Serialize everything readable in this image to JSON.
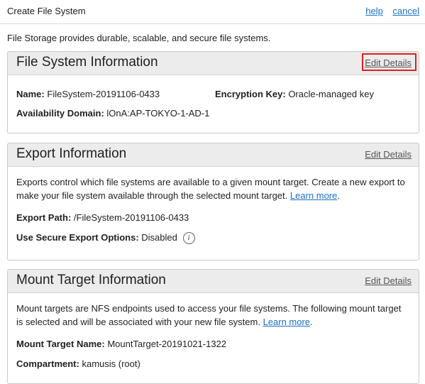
{
  "header": {
    "title": "Create File System",
    "help_label": "help",
    "cancel_label": "cancel"
  },
  "intro_text": "File Storage provides durable, scalable, and secure file systems.",
  "file_system_info": {
    "title": "File System Information",
    "edit_label": "Edit Details",
    "name_label": "Name:",
    "name_value": "FileSystem-20191106-0433",
    "encryption_label": "Encryption Key:",
    "encryption_value": "Oracle-managed key",
    "ad_label": "Availability Domain:",
    "ad_value": "lOnA:AP-TOKYO-1-AD-1"
  },
  "export_info": {
    "title": "Export Information",
    "edit_label": "Edit Details",
    "description": "Exports control which file systems are available to a given mount target. Create a new export to make your file system available through the selected mount target.",
    "learn_more": "Learn more",
    "export_path_label": "Export Path:",
    "export_path_value": "/FileSystem-20191106-0433",
    "secure_label": "Use Secure Export Options:",
    "secure_value": "Disabled",
    "info_icon_glyph": "i"
  },
  "mount_target_info": {
    "title": "Mount Target Information",
    "edit_label": "Edit Details",
    "description": "Mount targets are NFS endpoints used to access your file systems. The following mount target is selected and will be associated with your new file system.",
    "learn_more": "Learn more",
    "mt_name_label": "Mount Target Name:",
    "mt_name_value": "MountTarget-20191021-1322",
    "compartment_label": "Compartment:",
    "compartment_value": "kamusis (root)"
  },
  "colors": {
    "link": "#1a6fc9",
    "highlight": "#e02020",
    "panel_header": "#ececec"
  }
}
